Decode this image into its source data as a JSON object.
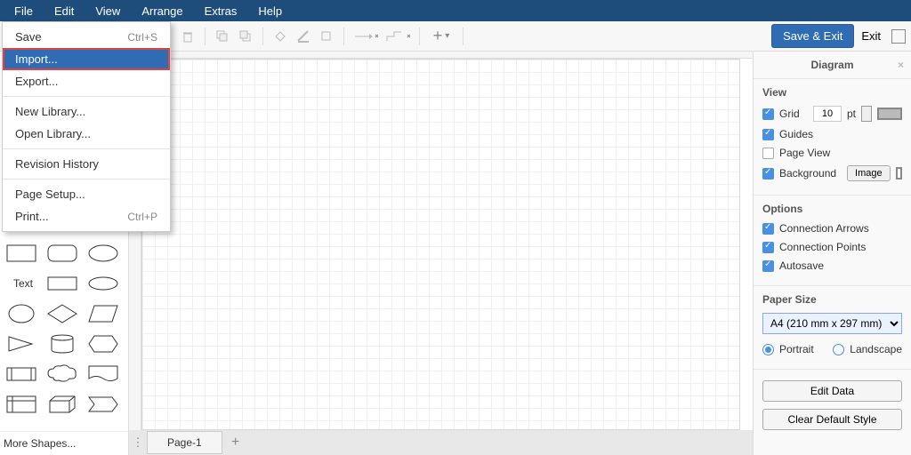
{
  "menubar": [
    "File",
    "Edit",
    "View",
    "Arrange",
    "Extras",
    "Help"
  ],
  "file_menu": {
    "items": [
      {
        "label": "Save",
        "shortcut": "Ctrl+S"
      },
      {
        "label": "Import...",
        "highlighted": true
      },
      {
        "label": "Export..."
      },
      {
        "sep": true
      },
      {
        "label": "New Library..."
      },
      {
        "label": "Open Library..."
      },
      {
        "sep": true
      },
      {
        "label": "Revision History"
      },
      {
        "sep": true
      },
      {
        "label": "Page Setup..."
      },
      {
        "label": "Print...",
        "shortcut": "Ctrl+P"
      }
    ]
  },
  "toolbar": {
    "save_exit": "Save & Exit",
    "exit": "Exit"
  },
  "shapes": {
    "text_label": "Text",
    "more": "More Shapes..."
  },
  "page_tab": "Page-1",
  "right": {
    "tab": "Diagram",
    "view": "View",
    "grid": "Grid",
    "grid_value": "10",
    "grid_unit": "pt",
    "guides": "Guides",
    "page_view": "Page View",
    "background": "Background",
    "image_btn": "Image",
    "options": "Options",
    "conn_arrows": "Connection Arrows",
    "conn_points": "Connection Points",
    "autosave": "Autosave",
    "paper_size": "Paper Size",
    "paper_value": "A4 (210 mm x 297 mm)",
    "portrait": "Portrait",
    "landscape": "Landscape",
    "edit_data": "Edit Data",
    "clear_style": "Clear Default Style"
  }
}
